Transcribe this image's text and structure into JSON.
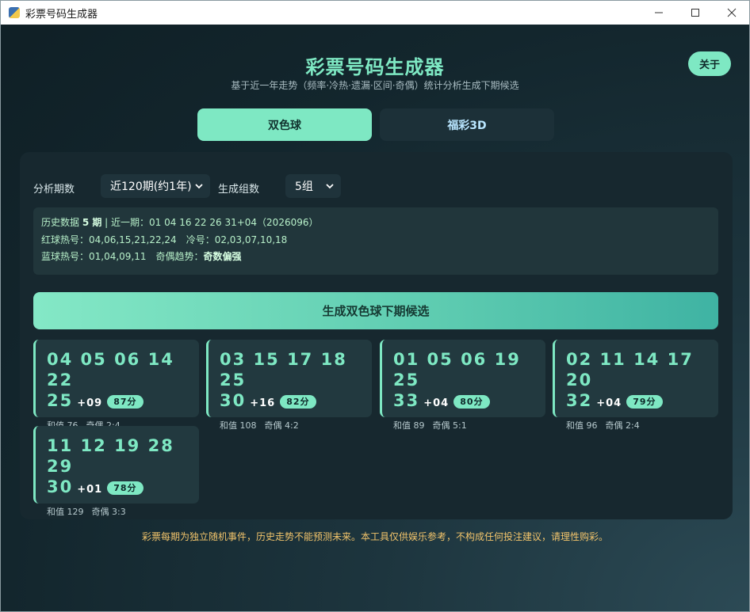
{
  "window": {
    "title": "彩票号码生成器"
  },
  "header": {
    "title": "彩票号码生成器",
    "subtitle": "基于近一年走势（频率·冷热·遗漏·区间·奇偶）统计分析生成下期候选",
    "about_label": "关于"
  },
  "tabs": [
    {
      "label": "双色球",
      "active": true
    },
    {
      "label": "福彩3D",
      "active": false
    }
  ],
  "controls": {
    "periods_label": "分析期数",
    "periods_value": "近120期(约1年)",
    "groups_label": "生成组数",
    "groups_value": "5组"
  },
  "info": {
    "history_prefix": "历史数据 ",
    "history_count": "5 期",
    "history_latest": " | 近一期：01 04 16 22 26 31+04（2026096）",
    "red_hot": "红球热号：04,06,15,21,22,24　冷号：02,03,07,10,18",
    "blue_hot_prefix": "蓝球热号：01,04,09,11　奇偶趋势：",
    "blue_trend": "奇数偏强"
  },
  "generate_label": "生成双色球下期候选",
  "results": [
    {
      "red1": "04 05 06 14 22",
      "red2": "25",
      "blue": "+09",
      "score": "87分",
      "sum": "和值 76",
      "oddeven": "奇偶 2:4"
    },
    {
      "red1": "03 15 17 18 25",
      "red2": "30",
      "blue": "+16",
      "score": "82分",
      "sum": "和值 108",
      "oddeven": "奇偶 4:2"
    },
    {
      "red1": "01 05 06 19 25",
      "red2": "33",
      "blue": "+04",
      "score": "80分",
      "sum": "和值 89",
      "oddeven": "奇偶 5:1"
    },
    {
      "red1": "02 11 14 17 20",
      "red2": "32",
      "blue": "+04",
      "score": "79分",
      "sum": "和值 96",
      "oddeven": "奇偶 2:4"
    },
    {
      "red1": "11 12 19 28 29",
      "red2": "30",
      "blue": "+01",
      "score": "78分",
      "sum": "和值 129",
      "oddeven": "奇偶 3:3"
    }
  ],
  "disclaimer": "彩票每期为独立随机事件，历史走势不能预测未来。本工具仅供娱乐参考，不构成任何投注建议，请理性购彩。",
  "colors": {
    "accent": "#7ee8c3",
    "warning": "#f2c46b",
    "panel": "#17282f"
  }
}
